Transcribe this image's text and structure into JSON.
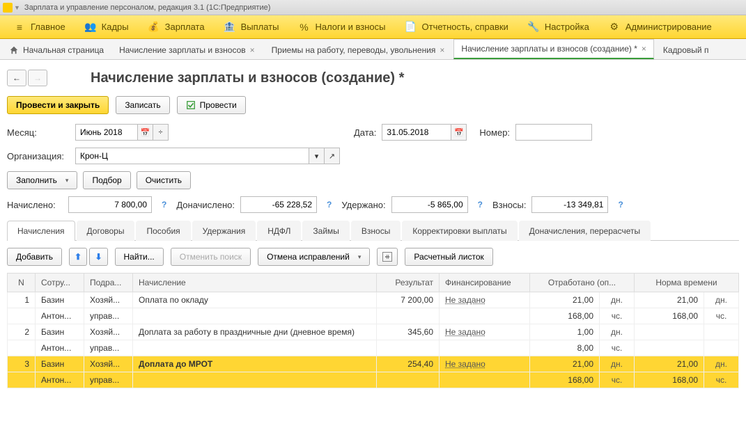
{
  "window": {
    "title": "Зарплата и управление персоналом, редакция 3.1  (1С:Предприятие)"
  },
  "mainmenu": [
    {
      "label": "Главное",
      "icon": "≡"
    },
    {
      "label": "Кадры",
      "icon": "👥"
    },
    {
      "label": "Зарплата",
      "icon": "💰"
    },
    {
      "label": "Выплаты",
      "icon": "🏦"
    },
    {
      "label": "Налоги и взносы",
      "icon": "%"
    },
    {
      "label": "Отчетность, справки",
      "icon": "📄"
    },
    {
      "label": "Настройка",
      "icon": "🔧"
    },
    {
      "label": "Администрирование",
      "icon": "⚙"
    }
  ],
  "tabs": [
    {
      "label": "Начальная страница",
      "home": true
    },
    {
      "label": "Начисление зарплаты и взносов",
      "close": true
    },
    {
      "label": "Приемы на работу, переводы, увольнения",
      "close": true
    },
    {
      "label": "Начисление зарплаты и взносов (создание) *",
      "close": true,
      "active": true
    },
    {
      "label": "Кадровый п"
    }
  ],
  "page": {
    "title": "Начисление зарплаты и взносов (создание) *"
  },
  "cmd": {
    "post_close": "Провести и закрыть",
    "save": "Записать",
    "post": "Провести"
  },
  "form": {
    "month_lbl": "Месяц:",
    "month_val": "Июнь 2018",
    "date_lbl": "Дата:",
    "date_val": "31.05.2018",
    "number_lbl": "Номер:",
    "number_val": "",
    "org_lbl": "Организация:",
    "org_val": "Крон-Ц",
    "fill": "Заполнить",
    "pick": "Подбор",
    "clear": "Очистить",
    "accrued_lbl": "Начислено:",
    "accrued_val": "7 800,00",
    "addl_lbl": "Доначислено:",
    "addl_val": "-65 228,52",
    "withheld_lbl": "Удержано:",
    "withheld_val": "-5 865,00",
    "contrib_lbl": "Взносы:",
    "contrib_val": "-13 349,81"
  },
  "doctabs": [
    "Начисления",
    "Договоры",
    "Пособия",
    "Удержания",
    "НДФЛ",
    "Займы",
    "Взносы",
    "Корректировки выплаты",
    "Доначисления, перерасчеты"
  ],
  "doctabs_active": 0,
  "tb2": {
    "add": "Добавить",
    "find": "Найти...",
    "cancel_search": "Отменить поиск",
    "cancel_fix": "Отмена исправлений",
    "payslip": "Расчетный листок"
  },
  "cols": {
    "n": "N",
    "emp": "Сотру...",
    "dep": "Подра...",
    "accrual": "Начисление",
    "result": "Результат",
    "fin": "Финансирование",
    "worked": "Отработано (оп...",
    "norm": "Норма времени"
  },
  "units": {
    "days": "дн.",
    "hours": "чс."
  },
  "fin_notset": "Не задано",
  "rows": [
    {
      "n": "1",
      "emp1": "Базин",
      "emp2": "Антон...",
      "dep1": "Хозяй...",
      "dep2": "управ...",
      "name": "Оплата по окладу",
      "result": "7 200,00",
      "wd": "21,00",
      "wh": "168,00",
      "nd": "21,00",
      "nh": "168,00"
    },
    {
      "n": "2",
      "emp1": "Базин",
      "emp2": "Антон...",
      "dep1": "Хозяй...",
      "dep2": "управ...",
      "name": "Доплата за работу в праздничные дни (дневное время)",
      "result": "345,60",
      "wd": "1,00",
      "wh": "8,00",
      "nd": "",
      "nh": ""
    },
    {
      "n": "3",
      "emp1": "Базин",
      "emp2": "Антон...",
      "dep1": "Хозяй...",
      "dep2": "управ...",
      "name": "Доплата до МРОТ",
      "result": "254,40",
      "wd": "21,00",
      "wh": "168,00",
      "nd": "21,00",
      "nh": "168,00",
      "selected": true,
      "bold": true
    }
  ]
}
